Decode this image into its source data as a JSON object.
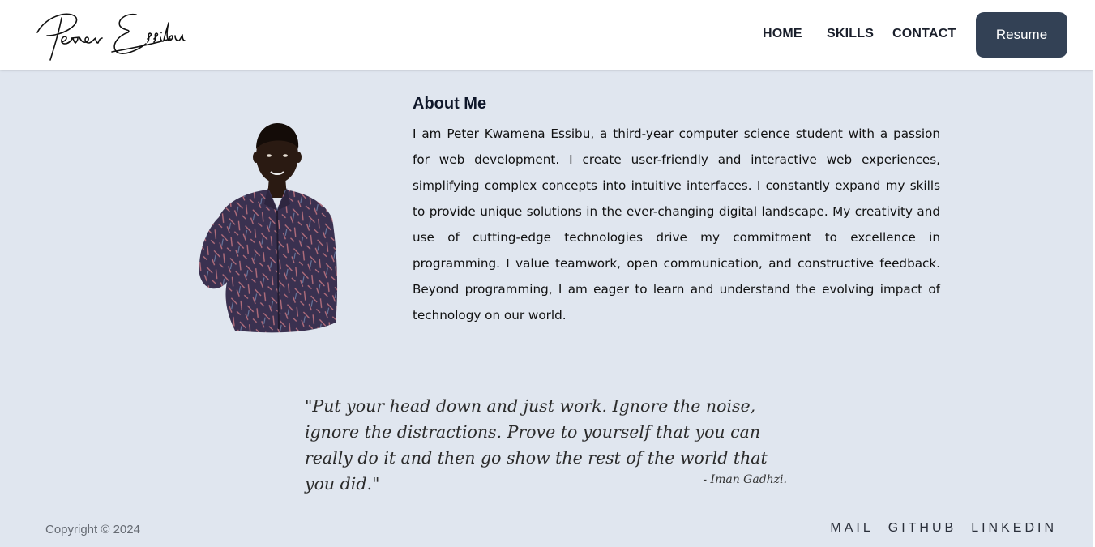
{
  "header": {
    "logo_text": "Peter Essibu",
    "nav": [
      {
        "label": "HOME"
      },
      {
        "label": "SKILLS"
      },
      {
        "label": "CONTACT"
      }
    ],
    "resume_label": "Resume"
  },
  "about": {
    "title": "About Me",
    "text": "I am Peter Kwamena Essibu, a third-year computer science student with a passion for web development. I create user-friendly and interactive web experiences, simplifying complex concepts into intuitive interfaces. I constantly expand my skills to provide unique solutions in the ever-changing digital landscape. My creativity and use of cutting-edge technologies drive my commitment to excellence in programming. I value teamwork, open communication, and constructive feedback. Beyond programming, I am eager to learn and understand the evolving impact of technology on our world."
  },
  "quote": {
    "text": "\"Put your head down and just work. Ignore the noise, ignore the distractions. Prove to yourself that you can really do it and then go show the rest of the world that you did.\"",
    "author": "- Iman Gadhzi."
  },
  "footer": {
    "copyright": "Copyright © 2024",
    "links": [
      {
        "label": "MAIL"
      },
      {
        "label": "GITHUB"
      },
      {
        "label": "LINKEDIN"
      }
    ]
  },
  "colors": {
    "page_bg": "#e0e6ef",
    "navbar_bg": "#ffffff",
    "button_bg": "#334155",
    "button_text": "#ffffff"
  }
}
